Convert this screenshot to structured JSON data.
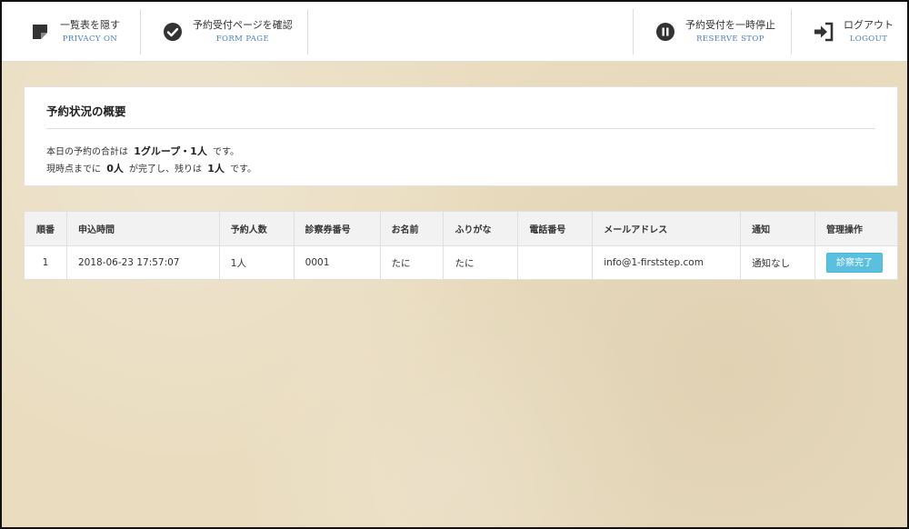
{
  "header": {
    "privacy": {
      "label_jp": "一覧表を隠す",
      "label_en": "Privacy ON",
      "icon": "note-icon"
    },
    "form_page": {
      "label_jp": "予約受付ページを確認",
      "label_en": "Form Page",
      "icon": "check-circle-icon"
    },
    "reserve_stop": {
      "label_jp": "予約受付を一時停止",
      "label_en": "Reserve Stop",
      "icon": "pause-circle-icon"
    },
    "logout": {
      "label_jp": "ログアウト",
      "label_en": "Logout",
      "icon": "sign-out-icon"
    }
  },
  "summary": {
    "title": "予約状況の概要",
    "line1_prefix": "本日の予約の合計は",
    "line1_value": "1グループ・1人",
    "line1_suffix": "です。",
    "line2_prefix": "現時点までに",
    "line2_value_done": "0人",
    "line2_middle": "が完了し、残りは",
    "line2_value_remaining": "1人",
    "line2_suffix": "です。"
  },
  "table": {
    "headers": [
      "順番",
      "申込時間",
      "予約人数",
      "診察券番号",
      "お名前",
      "ふりがな",
      "電話番号",
      "メールアドレス",
      "通知",
      "管理操作"
    ],
    "rows": [
      {
        "order": "1",
        "time": "2018-06-23 17:57:07",
        "people": "1人",
        "card_no": "0001",
        "name": "たに",
        "furigana": "たに",
        "phone": "",
        "email": "info@1-firststep.com",
        "notify": "通知なし",
        "action_label": "診察完了"
      }
    ]
  },
  "colors": {
    "accent_link": "#4a7fc0",
    "button_info": "#5bc0de",
    "background": "#e9dcbf"
  }
}
